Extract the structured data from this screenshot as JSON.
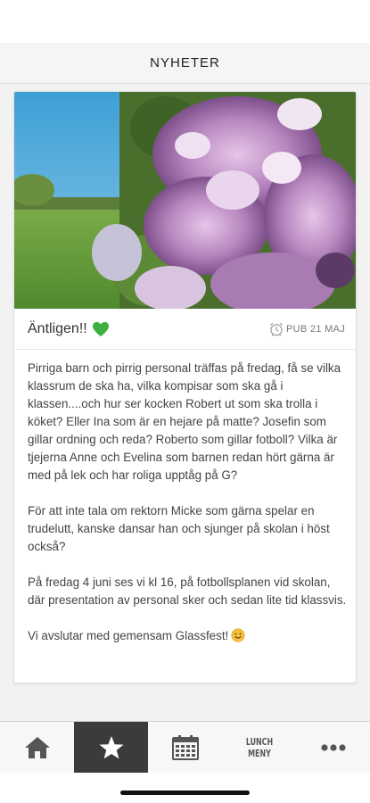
{
  "header": {
    "title": "NYHETER"
  },
  "article": {
    "title": "Äntligen!!",
    "title_emoji": "green-heart-icon",
    "pub_icon": "alarm-clock-icon",
    "pub_label": "PUB 21 MAJ",
    "paragraphs": [
      "Pirriga barn och pirrig personal träffas på fredag, få se vilka klassrum de ska ha, vilka kompisar som ska gå i klassen....och hur ser kocken Robert ut som ska trolla i köket? Eller Ina som är en hejare på matte? Josefin som gillar ordning och reda? Roberto som gillar fotboll? Vilka är tjejerna Anne och Evelina som barnen redan hört gärna är med på lek och har roliga upptåg på G?",
      "För att inte tala om rektorn Micke som gärna spelar en trudelutt, kanske dansar han och sjunger på skolan i höst också?",
      "På fredag 4 juni ses vi kl 16, på fotbollsplanen vid skolan, där presentation av personal sker och sedan lite tid klassvis.",
      "Vi avslutar med gemensam Glassfest!"
    ],
    "closing_emoji": "smiley-face-icon"
  },
  "tabbar": {
    "tabs": [
      {
        "icon": "home-icon",
        "active": false
      },
      {
        "icon": "star-icon",
        "active": true
      },
      {
        "icon": "calendar-icon",
        "active": false
      },
      {
        "label_line1": "LUNCH",
        "label_line2": "MENY",
        "active": false
      },
      {
        "icon": "more-dots-icon",
        "active": false
      }
    ]
  },
  "colors": {
    "header_bg": "#f5f5f5",
    "tab_active_bg": "#3b3b3b",
    "tab_icon": "#555555",
    "heart": "#3cb043"
  }
}
